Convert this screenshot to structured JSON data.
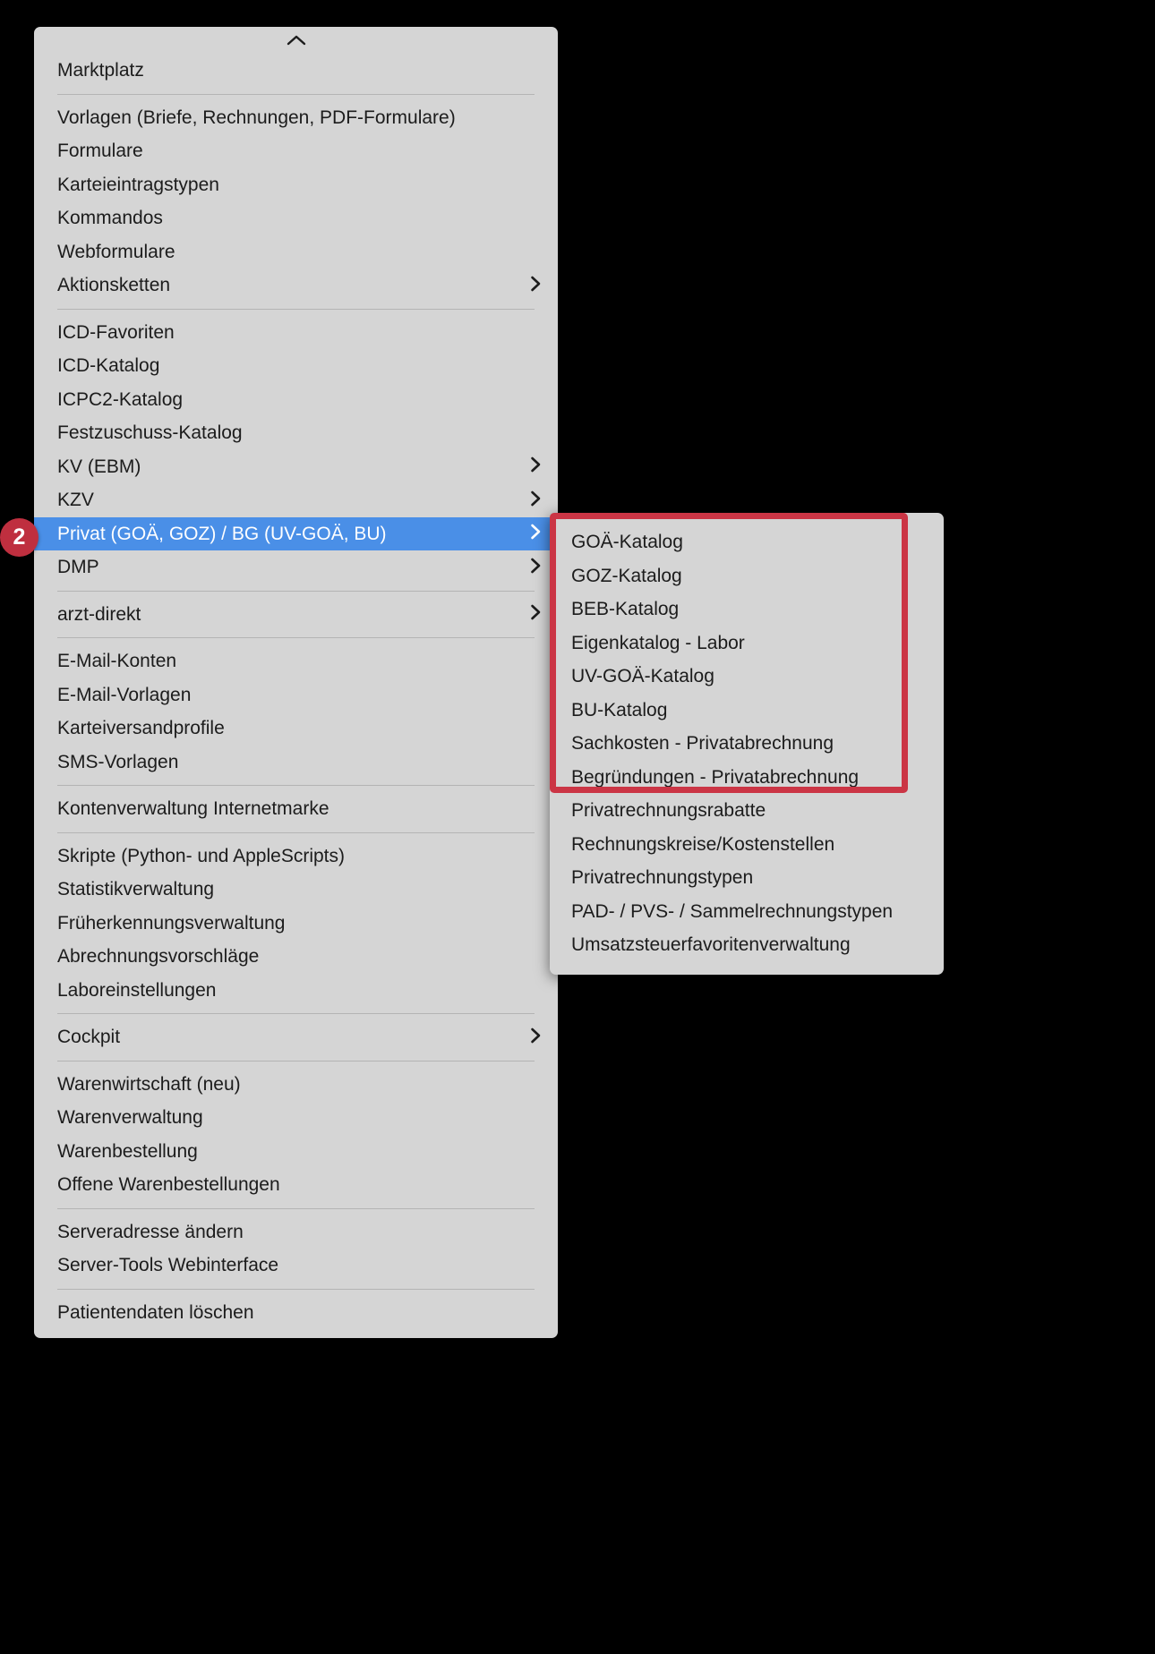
{
  "menu": {
    "scroll_up_icon": "chevron-up-icon",
    "groups": [
      {
        "items": [
          {
            "label": "Marktplatz",
            "submenu": false
          }
        ]
      },
      {
        "items": [
          {
            "label": "Vorlagen (Briefe, Rechnungen, PDF-Formulare)",
            "submenu": false
          },
          {
            "label": "Formulare",
            "submenu": false
          },
          {
            "label": "Karteieintragstypen",
            "submenu": false
          },
          {
            "label": "Kommandos",
            "submenu": false
          },
          {
            "label": "Webformulare",
            "submenu": false
          },
          {
            "label": "Aktionsketten",
            "submenu": true
          }
        ]
      },
      {
        "items": [
          {
            "label": "ICD-Favoriten",
            "submenu": false
          },
          {
            "label": "ICD-Katalog",
            "submenu": false
          },
          {
            "label": "ICPC2-Katalog",
            "submenu": false
          },
          {
            "label": "Festzuschuss-Katalog",
            "submenu": false
          },
          {
            "label": "KV (EBM)",
            "submenu": true
          },
          {
            "label": "KZV",
            "submenu": true
          },
          {
            "label": "Privat (GOÄ, GOZ) / BG (UV-GOÄ, BU)",
            "submenu": true,
            "selected": true
          },
          {
            "label": "DMP",
            "submenu": true
          }
        ]
      },
      {
        "items": [
          {
            "label": "arzt-direkt",
            "submenu": true
          }
        ]
      },
      {
        "items": [
          {
            "label": "E-Mail-Konten",
            "submenu": false
          },
          {
            "label": "E-Mail-Vorlagen",
            "submenu": false
          },
          {
            "label": "Karteiversandprofile",
            "submenu": false
          },
          {
            "label": "SMS-Vorlagen",
            "submenu": false
          }
        ]
      },
      {
        "items": [
          {
            "label": "Kontenverwaltung Internetmarke",
            "submenu": false
          }
        ]
      },
      {
        "items": [
          {
            "label": "Skripte (Python- und AppleScripts)",
            "submenu": false
          },
          {
            "label": "Statistikverwaltung",
            "submenu": false
          },
          {
            "label": "Früherkennungsverwaltung",
            "submenu": false
          },
          {
            "label": "Abrechnungsvorschläge",
            "submenu": false
          },
          {
            "label": "Laboreinstellungen",
            "submenu": false
          }
        ]
      },
      {
        "items": [
          {
            "label": "Cockpit",
            "submenu": true
          }
        ]
      },
      {
        "items": [
          {
            "label": "Warenwirtschaft (neu)",
            "submenu": false
          },
          {
            "label": "Warenverwaltung",
            "submenu": false
          },
          {
            "label": "Warenbestellung",
            "submenu": false
          },
          {
            "label": "Offene Warenbestellungen",
            "submenu": false
          }
        ]
      },
      {
        "items": [
          {
            "label": "Serveradresse ändern",
            "submenu": false
          },
          {
            "label": "Server-Tools Webinterface",
            "submenu": false
          }
        ]
      },
      {
        "items": [
          {
            "label": "Patientendaten löschen",
            "submenu": false
          }
        ]
      }
    ]
  },
  "submenu": {
    "items": [
      {
        "label": "GOÄ-Katalog",
        "highlighted": true
      },
      {
        "label": "GOZ-Katalog",
        "highlighted": true
      },
      {
        "label": "BEB-Katalog",
        "highlighted": true
      },
      {
        "label": "Eigenkatalog - Labor",
        "highlighted": true
      },
      {
        "label": "UV-GOÄ-Katalog",
        "highlighted": true
      },
      {
        "label": "BU-Katalog",
        "highlighted": true
      },
      {
        "label": "Sachkosten - Privatabrechnung",
        "highlighted": true
      },
      {
        "label": "Begründungen - Privatabrechnung",
        "highlighted": true
      },
      {
        "label": "Privatrechnungsrabatte",
        "highlighted": false
      },
      {
        "label": "Rechnungskreise/Kostenstellen",
        "highlighted": false
      },
      {
        "label": "Privatrechnungstypen",
        "highlighted": false
      },
      {
        "label": "PAD- / PVS- / Sammelrechnungstypen",
        "highlighted": false
      },
      {
        "label": "Umsatzsteuerfavoritenverwaltung",
        "highlighted": false
      }
    ]
  },
  "annotation": {
    "badge_label": "2",
    "badge_color": "#bf2f3f",
    "highlight_box_color": "#cb3545",
    "selection_color": "#4a8fe7"
  }
}
